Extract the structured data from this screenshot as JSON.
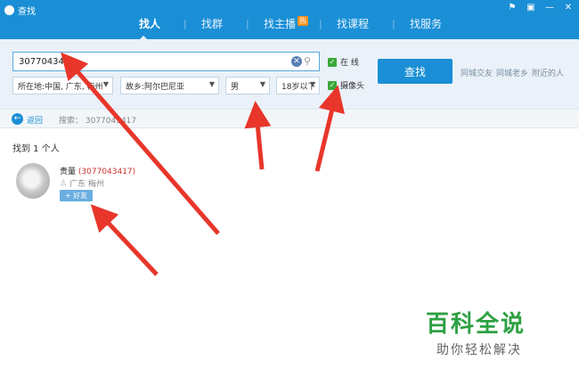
{
  "window": {
    "title": "查找",
    "buttons": [
      "⚑",
      "▣",
      "—",
      "✕"
    ]
  },
  "tabs": [
    {
      "label": "找人",
      "active": true
    },
    {
      "label": "找群",
      "active": false
    },
    {
      "label": "找主播",
      "active": false,
      "badge": "热"
    },
    {
      "label": "找课程",
      "active": false
    },
    {
      "label": "找服务",
      "active": false
    }
  ],
  "search": {
    "value": "3077043417",
    "location": "所在地:中国, 广东, 梅州",
    "hometown": "故乡:阿尔巴尼亚",
    "gender": "男",
    "age": "18岁以下",
    "online_label": "在  线",
    "camera_label": "摄像头",
    "button_label": "查找",
    "quick_links": [
      "同城交友",
      "同城老乡",
      "附近的人"
    ]
  },
  "results_bar": {
    "back_label": "返回",
    "summary": "搜索： 3077043417"
  },
  "results": {
    "count_text": "找到 1 个人",
    "user_name": "贵量",
    "user_qq": "(3077043417)",
    "user_location": "广东 梅州",
    "add_friend_label": "+ 好友"
  },
  "watermark": {
    "title": "百科全说",
    "subtitle": "助你轻松解决"
  },
  "colors": {
    "accent": "#1a8fd6",
    "arrow": "#e8362b",
    "watermark": "#2ea043"
  }
}
